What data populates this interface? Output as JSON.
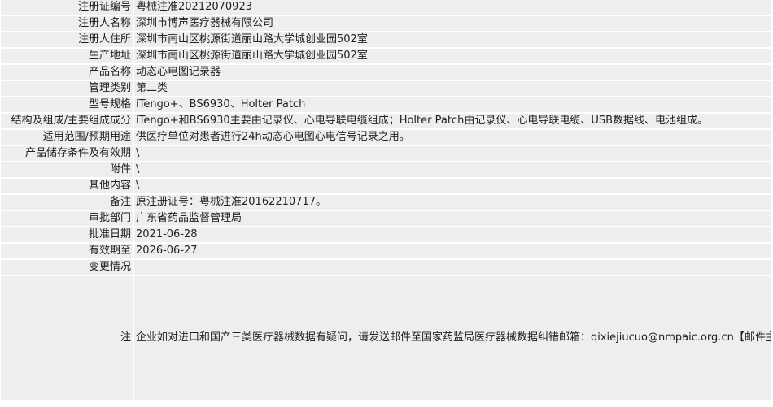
{
  "rows": [
    {
      "label": "注册证编号",
      "value": "粤械注准20212070923"
    },
    {
      "label": "注册人名称",
      "value": "深圳市博声医疗器械有限公司"
    },
    {
      "label": "注册人住所",
      "value": "深圳市南山区桃源街道丽山路大学城创业园502室"
    },
    {
      "label": "生产地址",
      "value": "深圳市南山区桃源街道丽山路大学城创业园502室"
    },
    {
      "label": "产品名称",
      "value": "动态心电图记录器"
    },
    {
      "label": "管理类别",
      "value": "第二类"
    },
    {
      "label": "型号规格",
      "value": "iTengo+、BS6930、Holter Patch"
    },
    {
      "label": "结构及组成/主要组成成分",
      "value": "iTengo+和BS6930主要由记录仪、心电导联电缆组成；Holter Patch由记录仪、心电导联电缆、USB数据线、电池组成。"
    },
    {
      "label": "适用范围/预期用途",
      "value": "供医疗单位对患者进行24h动态心电图心电信号记录之用。"
    },
    {
      "label": "产品储存条件及有效期",
      "value": "\\"
    },
    {
      "label": "附件",
      "value": "\\"
    },
    {
      "label": "其他内容",
      "value": "\\"
    },
    {
      "label": "备注",
      "value": "原注册证号：粤械注准20162210717。"
    },
    {
      "label": "审批部门",
      "value": "广东省药品监督管理局"
    },
    {
      "label": "批准日期",
      "value": "2021-06-28"
    },
    {
      "label": "有效期至",
      "value": "2026-06-27"
    }
  ],
  "change": {
    "label": "变更情况",
    "value": ""
  },
  "note": {
    "label": "注",
    "text": "企业如对进口和国产三类医疗器械数据有疑问，请发送邮件至国家药监局医疗器械数据纠错邮箱：qixiejiucuo@nmpaic.org.cn【邮件主题请注明“医疗器械数据问题”，邮件正文中请准确填写以下全部信息：1.医疗器械注册证号/备案号；2.类型（注册、变更、延续等）；3.问题描述（500字以内）；4.企业名称（全称）；5.统一社会信用代码；6.联系人姓名；7.联系电话（手机和座机）；8.联系邮箱】，或致电国家药监局医疗器械数据纠错电话010-88331514（此电话为我局医疗器械数据纠错联系电话，并非相应产品/企业业务咨询电话）。企业如对国产一类和二类医疗器械数据有疑问，请咨询国家局信息中心，电话010-88332877，88331520（工作日），也可通过发邮件与我们联系：邮件地址yaopinshuju@nmpaic.org.cn，邮件主题请注明“国产医疗器械产品（注册）-数据（注册证号/备案号）数据问题”。国产一类和二类医疗器械数据来源于省局，由省局通过数据共享平台进行纠错和维护。"
  }
}
